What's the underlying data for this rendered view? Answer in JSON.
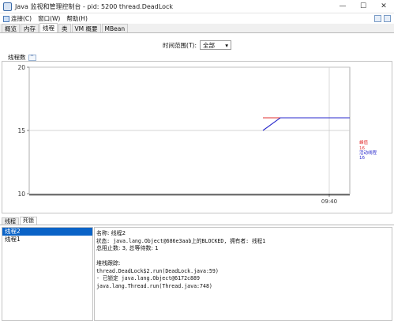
{
  "window": {
    "title": "Java 监视和管理控制台 - pid: 5200 thread.DeadLock",
    "minimize": "—",
    "maximize": "☐",
    "close": "✕"
  },
  "menu": {
    "items": [
      {
        "label": "连接(C)",
        "icon": "connect-icon"
      },
      {
        "label": "窗口(W)"
      },
      {
        "label": "帮助(H)"
      }
    ]
  },
  "tabs": [
    "概览",
    "内存",
    "线程",
    "类",
    "VM 概要",
    "MBean"
  ],
  "active_tab": "线程",
  "time_range": {
    "label": "时间范围(T):",
    "value": "全部"
  },
  "chart_title": "线程数",
  "chart_data": {
    "type": "line",
    "ylim": [
      10,
      20
    ],
    "yticks": [
      10,
      15,
      20
    ],
    "xticks": [
      "09:40"
    ],
    "series": [
      {
        "name": "峰值",
        "color": "#e23030",
        "points": [
          [
            0,
            16
          ],
          [
            1,
            16
          ]
        ]
      },
      {
        "name": "活动线程",
        "color": "#2a2acc",
        "points": [
          [
            0,
            15
          ],
          [
            0.2,
            16
          ],
          [
            1,
            16
          ]
        ]
      }
    ],
    "legend": [
      {
        "name": "峰值",
        "value": "",
        "color": "#e23030"
      },
      {
        "name": "",
        "value": "16",
        "color": "#e23030"
      },
      {
        "name": "活动线程",
        "value": "",
        "color": "#2a2acc"
      },
      {
        "name": "",
        "value": "16",
        "color": "#2a2acc"
      }
    ]
  },
  "lower_tabs": [
    "线程",
    "死锁"
  ],
  "active_lower_tab": "死锁",
  "threads": [
    "线程2",
    "线程1"
  ],
  "detail": {
    "name": "名称:  线程2",
    "state": "状态:  java.lang.Object@686e3aab上的BLOCKED, 拥有者:  线程1",
    "totals": "总阻止数:  3, 总等待数:  1",
    "stack_title": "堆栈跟踪:",
    "stack": [
      "thread.DeadLock$2.run(DeadLock.java:59)",
      "   - 已锁定 java.lang.Object@6172c889",
      "java.lang.Thread.run(Thread.java:748)"
    ]
  }
}
